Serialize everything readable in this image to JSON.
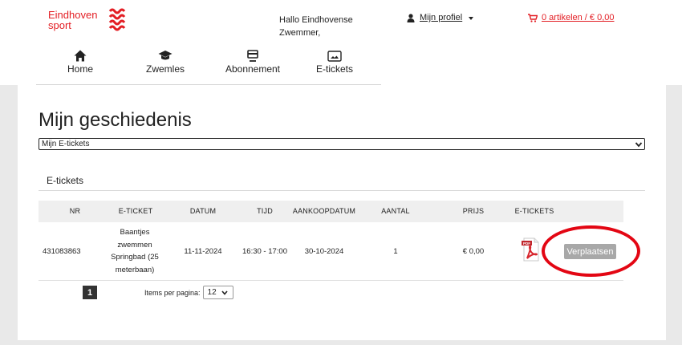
{
  "brand": {
    "line1": "Eindhoven",
    "line2": "sport",
    "color": "#e31e24"
  },
  "header": {
    "greeting_line1": "Hallo Eindhovense",
    "greeting_line2": "Zwemmer,",
    "profile_label": "Mijn profiel",
    "cart_label": "0 artikelen / € 0,00"
  },
  "nav": {
    "items": [
      {
        "label": "Home",
        "icon": "home-icon"
      },
      {
        "label": "Zwemles",
        "icon": "graduation-cap-icon"
      },
      {
        "label": "Abonnement",
        "icon": "card-icon"
      },
      {
        "label": "E-tickets",
        "icon": "ticket-icon"
      }
    ]
  },
  "main": {
    "title": "Mijn geschiedenis",
    "filter_value": "Mijn E-tickets",
    "section_title": "E-tickets",
    "columns": [
      "NR",
      "E-TICKET",
      "DATUM",
      "TIJD",
      "AANKOOPDATUM",
      "AANTAL",
      "PRIJS",
      "E-TICKETS"
    ],
    "rows": [
      {
        "nr": "431083863",
        "ticket_lines": [
          "Baantjes",
          "zwemmen",
          "Springbad (25",
          "meterbaan)"
        ],
        "datum": "11-11-2024",
        "tijd": "16:30 - 17:00",
        "aankoopdatum": "30-10-2024",
        "aantal": "1",
        "prijs": "€ 0,00",
        "pdf_icon": "pdf-icon",
        "action_label": "Verplaatsen"
      }
    ],
    "pagination": {
      "current_page": "1",
      "per_page_label": "Items per pagina:",
      "per_page_value": "12"
    }
  },
  "colors": {
    "accent_red": "#e31e24",
    "highlight_ring": "#e30613",
    "button_gray": "#a8a8a8"
  }
}
